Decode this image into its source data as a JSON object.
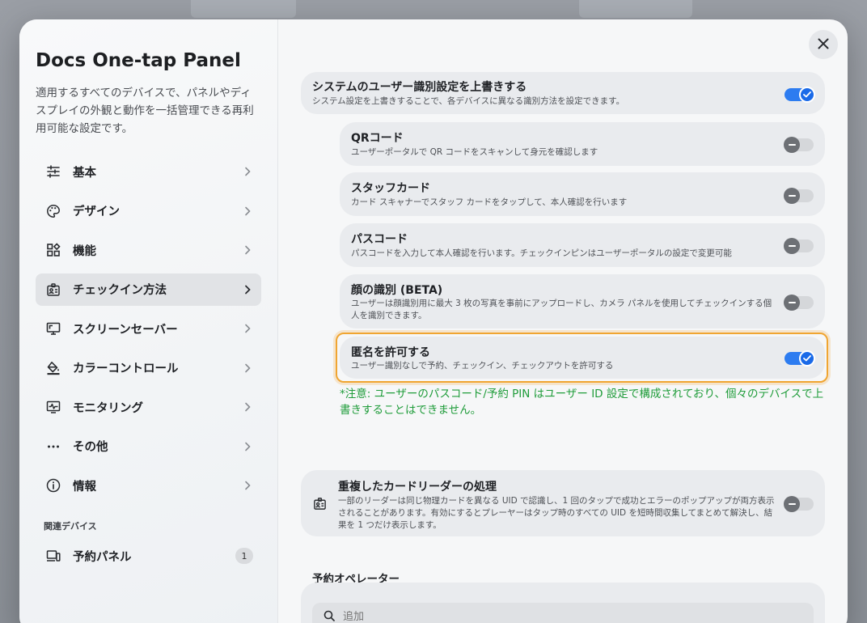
{
  "app": {
    "title": "Docs One-tap Panel",
    "description": "適用するすべてのデバイスで、パネルやディスプレイの外観と動作を一括管理できる再利用可能な設定です。"
  },
  "nav": [
    {
      "label": "基本",
      "icon": "sliders-icon",
      "active": false
    },
    {
      "label": "デザイン",
      "icon": "palette-icon",
      "active": false
    },
    {
      "label": "機能",
      "icon": "apps-add-icon",
      "active": false
    },
    {
      "label": "チェックイン方法",
      "icon": "id-badge-icon",
      "active": true
    },
    {
      "label": "スクリーンセーバー",
      "icon": "monitor-icon",
      "active": false
    },
    {
      "label": "カラーコントロール",
      "icon": "paint-bucket-icon",
      "active": false
    },
    {
      "label": "モニタリング",
      "icon": "pulse-monitor-icon",
      "active": false
    },
    {
      "label": "その他",
      "icon": "more-dots-icon",
      "active": false
    },
    {
      "label": "情報",
      "icon": "info-icon",
      "active": false
    }
  ],
  "related": {
    "section_label": "関連デバイス",
    "device_label": "予約パネル",
    "count": "1"
  },
  "override": {
    "title": "システムのユーザー識別設定を上書きする",
    "desc": "システム設定を上書きすることで、各デバイスに異なる識別方法を設定できます。",
    "enabled": true
  },
  "methods": [
    {
      "title": "QRコード",
      "desc": "ユーザーポータルで QR コードをスキャンして身元を確認します",
      "enabled": false
    },
    {
      "title": "スタッフカード",
      "desc": "カード スキャナーでスタッフ カードをタップして、本人確認を行います",
      "enabled": false
    },
    {
      "title": "パスコード",
      "desc": "パスコードを入力して本人確認を行います。チェックインピンはユーザーポータルの設定で変更可能",
      "enabled": false
    },
    {
      "title": "顔の識別 (BETA)",
      "desc": "ユーザーは顔識別用に最大 3 枚の写真を事前にアップロードし、カメラ パネルを使用してチェックインする個人を識別できます。",
      "enabled": false
    },
    {
      "title": "匿名を許可する",
      "desc": "ユーザー識別なしで予約、チェックイン、チェックアウトを許可する",
      "enabled": true
    }
  ],
  "note": "*注意: ユーザーのパスコード/予約 PIN はユーザー ID 設定で構成されており、個々のデバイスで上書きすることはできません。",
  "duplicate_reader": {
    "title": "重複したカードリーダーの処理",
    "desc": "一部のリーダーは同じ物理カードを異なる UID で認識し、1 回のタップで成功とエラーのポップアップが両方表示されることがあります。有効にするとプレーヤーはタップ時のすべての UID を短時間収集してまとめて解決し、結果を 1 つだけ表示します。",
    "enabled": false
  },
  "operators": {
    "title": "予約オペレーター",
    "search_placeholder": "追加"
  },
  "colors": {
    "accent": "#1a6ae8",
    "highlight": "#f0a531",
    "note": "#1f9c3a"
  }
}
